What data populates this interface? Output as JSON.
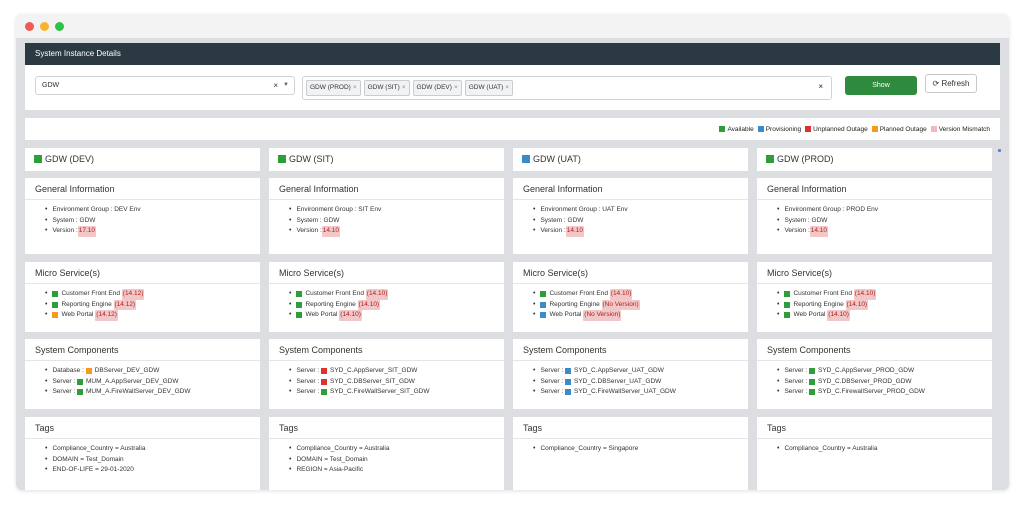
{
  "header": {
    "title": "System Instance Details"
  },
  "filters": {
    "system_value": "GDW",
    "environments": [
      "GDW (PROD)",
      "GDW (SIT)",
      "GDW (DEV)",
      "GDW (UAT)"
    ],
    "show_label": "Show",
    "refresh_label": "Refresh"
  },
  "legend": [
    {
      "label": "Available",
      "color": "#2e9e3a"
    },
    {
      "label": "Provisioning",
      "color": "#3b8bc8"
    },
    {
      "label": "Unplanned Outage",
      "color": "#e03131"
    },
    {
      "label": "Planned Outage",
      "color": "#f59a1a"
    },
    {
      "label": "Version Mismatch",
      "color": "#f4b8c0"
    }
  ],
  "colors": {
    "available": "#2e9e3a",
    "provisioning": "#3b8bc8",
    "unplanned": "#e03131",
    "planned": "#f59a1a",
    "mismatch": "#f4b8c0"
  },
  "sections": {
    "general": "General Information",
    "micro": "Micro Service(s)",
    "components": "System Components",
    "tags": "Tags"
  },
  "columns": [
    {
      "env": "GDW (DEV)",
      "status": "available",
      "general": [
        {
          "label": "Environment Group : DEV Env"
        },
        {
          "label": "System : GDW"
        },
        {
          "label": "Version : ",
          "badge": "17.10"
        }
      ],
      "micro": [
        {
          "status": "available",
          "label": "Customer Front End ",
          "badge": "(14.12)"
        },
        {
          "status": "available",
          "label": "Reporting Engine ",
          "badge": "(14.12)"
        },
        {
          "status": "planned",
          "label": "Web Portal ",
          "badge": "(14.12)"
        }
      ],
      "components": [
        {
          "prefix": "Database : ",
          "status": "planned",
          "label": "DBServer_DEV_GDW"
        },
        {
          "prefix": "Server : ",
          "status": "available",
          "label": "MUM_A.AppServer_DEV_GDW"
        },
        {
          "prefix": "Server : ",
          "status": "available",
          "label": "MUM_A.FireWallServer_DEV_GDW"
        }
      ],
      "tags": [
        "Compliance_Country = Australia",
        "DOMAIN = Test_Domain",
        "END-OF-LIFE = 29-01-2020"
      ]
    },
    {
      "env": "GDW (SIT)",
      "status": "available",
      "general": [
        {
          "label": "Environment Group : SIT Env"
        },
        {
          "label": "System : GDW"
        },
        {
          "label": "Version : ",
          "badge": "14.10"
        }
      ],
      "micro": [
        {
          "status": "available",
          "label": "Customer Front End ",
          "badge": "(14.10)"
        },
        {
          "status": "available",
          "label": "Reporting Engine ",
          "badge": "(14.10)"
        },
        {
          "status": "available",
          "label": "Web Portal ",
          "badge": "(14.10)"
        }
      ],
      "components": [
        {
          "prefix": "Server : ",
          "status": "unplanned",
          "label": "SYD_C.AppServer_SIT_GDW"
        },
        {
          "prefix": "Server : ",
          "status": "unplanned",
          "label": "SYD_C.DBServer_SIT_GDW"
        },
        {
          "prefix": "Server : ",
          "status": "available",
          "label": "SYD_C.FireWallServer_SIT_GDW"
        }
      ],
      "tags": [
        "Compliance_Country = Australia",
        "DOMAIN = Test_Domain",
        "REGION = Asia-Pacific"
      ]
    },
    {
      "env": "GDW (UAT)",
      "status": "provisioning",
      "general": [
        {
          "label": "Environment Group : UAT Env"
        },
        {
          "label": "System : GDW"
        },
        {
          "label": "Version : ",
          "badge": "14.10"
        }
      ],
      "micro": [
        {
          "status": "available",
          "label": "Customer Front End ",
          "badge": "(14.10)"
        },
        {
          "status": "provisioning",
          "label": "Reporting Engine ",
          "badge": "(No Version)"
        },
        {
          "status": "provisioning",
          "label": "Web Portal ",
          "badge": "(No Version)"
        }
      ],
      "components": [
        {
          "prefix": "Server : ",
          "status": "provisioning",
          "label": "SYD_C.AppServer_UAT_GDW"
        },
        {
          "prefix": "Server : ",
          "status": "provisioning",
          "label": "SYD_C.DBServer_UAT_GDW"
        },
        {
          "prefix": "Server : ",
          "status": "provisioning",
          "label": "SYD_C.FireWallServer_UAT_GDW"
        }
      ],
      "tags": [
        "Compliance_Country = Singapore"
      ]
    },
    {
      "env": "GDW (PROD)",
      "status": "available",
      "general": [
        {
          "label": "Environment Group : PROD Env"
        },
        {
          "label": "System : GDW"
        },
        {
          "label": "Version : ",
          "badge": "14.10"
        }
      ],
      "micro": [
        {
          "status": "available",
          "label": "Customer Front End ",
          "badge": "(14.10)"
        },
        {
          "status": "available",
          "label": "Reporting Engine ",
          "badge": "(14.10)"
        },
        {
          "status": "available",
          "label": "Web Portal ",
          "badge": "(14.10)"
        }
      ],
      "components": [
        {
          "prefix": "Server : ",
          "status": "available",
          "label": "SYD_C.AppServer_PROD_GDW"
        },
        {
          "prefix": "Server : ",
          "status": "available",
          "label": "SYD_C.DBServer_PROD_GDW"
        },
        {
          "prefix": "Server : ",
          "status": "available",
          "label": "SYD_C.FirewallServer_PROD_GDW"
        }
      ],
      "tags": [
        "Compliance_Country = Australia"
      ]
    }
  ]
}
